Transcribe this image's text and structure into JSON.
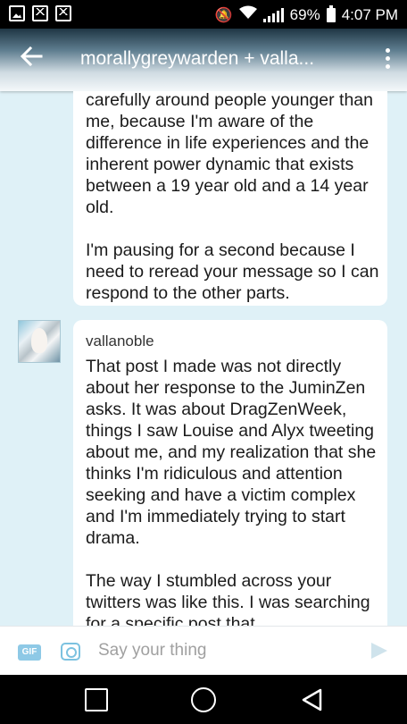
{
  "status_bar": {
    "battery": "69%",
    "time": "4:07 PM"
  },
  "app_bar": {
    "title": "morallygreywarden + valla..."
  },
  "messages": [
    {
      "sender": "",
      "paragraphs": [
        "carefully around people younger than me, because I'm aware of the difference in life experiences and the inherent power dynamic that exists between a 19 year old and a 14 year old.",
        "I'm pausing for a second because I need to reread your message so I can respond to the other parts."
      ]
    },
    {
      "sender": "vallanoble",
      "paragraphs": [
        "That post I made was not directly about her response to the JuminZen asks. It was about DragZenWeek, things I saw Louise and Alyx tweeting about me, and my realization that she thinks I'm ridiculous and attention seeking and have a victim complex and I'm immediately trying to start drama.",
        "The way I stumbled across your twitters was like this. I was searching for a specific post that"
      ]
    }
  ],
  "input_bar": {
    "gif_label": "GIF",
    "placeholder": "Say your thing"
  },
  "colors": {
    "background": "#dff1f7",
    "accent": "#7cc2e0"
  }
}
